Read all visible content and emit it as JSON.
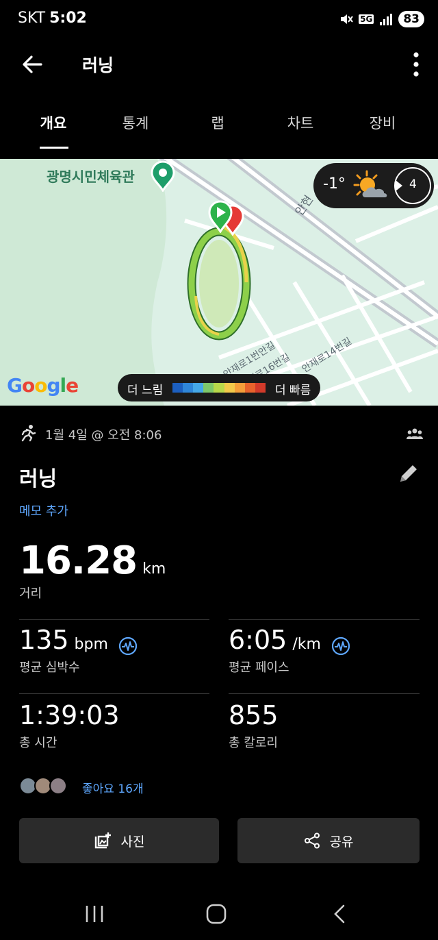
{
  "status": {
    "carrier": "SKT",
    "time": "5:02",
    "network": "5G",
    "battery": "83"
  },
  "app_bar": {
    "title": "러닝"
  },
  "tabs": [
    {
      "label": "개요",
      "active": true
    },
    {
      "label": "통계",
      "active": false
    },
    {
      "label": "랩",
      "active": false
    },
    {
      "label": "차트",
      "active": false
    },
    {
      "label": "장비",
      "active": false
    }
  ],
  "map": {
    "poi": "광명시민체육관",
    "weather_temp": "-1°",
    "wind_speed": "4",
    "provider": "Google",
    "speed_slow": "더 느림",
    "speed_fast": "더 빠름",
    "speed_colors": [
      "#1c5fbf",
      "#2f86d9",
      "#45a8e8",
      "#7ec86a",
      "#b8d84a",
      "#f2c94a",
      "#f59e3a",
      "#e8632c",
      "#d23a2a"
    ],
    "street_labels": [
      "안재로1번안길",
      "안재로16번길",
      "안재로14번길",
      "안현"
    ]
  },
  "activity": {
    "datetime": "1월 4일 @ 오전 8:06",
    "title": "러닝",
    "memo": "메모 추가",
    "distance": {
      "value": "16.28",
      "unit": "km",
      "label": "거리"
    },
    "heart_rate": {
      "value": "135",
      "unit": "bpm",
      "label": "평균 심박수"
    },
    "pace": {
      "value": "6:05",
      "unit": "/km",
      "label": "평균 페이스"
    },
    "duration": {
      "value": "1:39:03",
      "label": "총 시간"
    },
    "calories": {
      "value": "855",
      "label": "총 칼로리"
    },
    "likes": "좋아요 16개"
  },
  "buttons": {
    "photo": "사진",
    "share": "공유"
  },
  "colors": {
    "accent": "#5fa8ff",
    "route": "#7ec242",
    "start_pin": "#2db34a",
    "end_pin": "#e53935"
  }
}
